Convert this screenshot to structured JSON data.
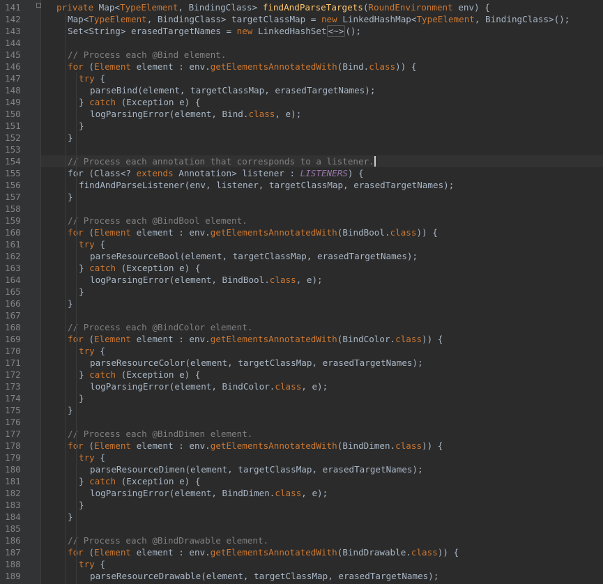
{
  "editor": {
    "first_line": 141,
    "current_line": 154,
    "lines": [
      {
        "n": "141",
        "i": 0,
        "t": [
          [
            "kw",
            "private "
          ],
          [
            "p",
            "Map<"
          ],
          [
            "type",
            "TypeElement"
          ],
          [
            "p",
            ", BindingClass> "
          ],
          [
            "fn",
            "findAndParseTargets"
          ],
          [
            "p",
            "("
          ],
          [
            "type",
            "RoundEnvironment"
          ],
          [
            "p",
            " env) {"
          ]
        ]
      },
      {
        "n": "142",
        "i": 1,
        "t": [
          [
            "p",
            "Map<"
          ],
          [
            "type",
            "TypeElement"
          ],
          [
            "p",
            ", BindingClass> targetClassMap = "
          ],
          [
            "kw",
            "new "
          ],
          [
            "p",
            "LinkedHashMap<"
          ],
          [
            "type",
            "TypeElement"
          ],
          [
            "p",
            ", BindingClass>();"
          ]
        ]
      },
      {
        "n": "143",
        "i": 1,
        "t": [
          [
            "p",
            "Set<String> erasedTargetNames = "
          ],
          [
            "kw",
            "new "
          ],
          [
            "p",
            "LinkedHashSet"
          ],
          [
            "hint",
            "<~>"
          ],
          [
            "p",
            "();"
          ]
        ]
      },
      {
        "n": "144",
        "i": 1,
        "t": []
      },
      {
        "n": "145",
        "i": 1,
        "t": [
          [
            "cm",
            "// Process each @Bind element."
          ]
        ]
      },
      {
        "n": "146",
        "i": 1,
        "t": [
          [
            "kw",
            "for "
          ],
          [
            "p",
            "("
          ],
          [
            "type",
            "Element"
          ],
          [
            "p",
            " element : env."
          ],
          [
            "type",
            "getElementsAnnotatedWith"
          ],
          [
            "p",
            "(Bind."
          ],
          [
            "kw",
            "class"
          ],
          [
            "p",
            ")) {"
          ]
        ]
      },
      {
        "n": "147",
        "i": 2,
        "t": [
          [
            "kw",
            "try "
          ],
          [
            "p",
            "{"
          ]
        ]
      },
      {
        "n": "148",
        "i": 3,
        "t": [
          [
            "p",
            "parseBind(element, targetClassMap, erasedTargetNames);"
          ]
        ]
      },
      {
        "n": "149",
        "i": 2,
        "t": [
          [
            "p",
            "} "
          ],
          [
            "kw",
            "catch "
          ],
          [
            "p",
            "(Exception e) {"
          ]
        ]
      },
      {
        "n": "150",
        "i": 3,
        "t": [
          [
            "p",
            "logParsingError(element, Bind."
          ],
          [
            "kw",
            "class"
          ],
          [
            "p",
            ", e);"
          ]
        ]
      },
      {
        "n": "151",
        "i": 2,
        "t": [
          [
            "p",
            "}"
          ]
        ]
      },
      {
        "n": "152",
        "i": 1,
        "t": [
          [
            "p",
            "}"
          ]
        ]
      },
      {
        "n": "153",
        "i": 1,
        "t": []
      },
      {
        "n": "154",
        "i": 1,
        "t": [
          [
            "cm",
            "// Process each annotation that corresponds to a listener."
          ]
        ]
      },
      {
        "n": "155",
        "i": 1,
        "t": [
          [
            "p",
            "for (Class<? "
          ],
          [
            "kw",
            "extends "
          ],
          [
            "p",
            "Annotation> listener : "
          ],
          [
            "const",
            "LISTENERS"
          ],
          [
            "p",
            ") {"
          ]
        ]
      },
      {
        "n": "156",
        "i": 2,
        "t": [
          [
            "p",
            "findAndParseListener(env, listener, targetClassMap, erasedTargetNames);"
          ]
        ]
      },
      {
        "n": "157",
        "i": 1,
        "t": [
          [
            "p",
            "}"
          ]
        ]
      },
      {
        "n": "158",
        "i": 1,
        "t": []
      },
      {
        "n": "159",
        "i": 1,
        "t": [
          [
            "cm",
            "// Process each @BindBool element."
          ]
        ]
      },
      {
        "n": "160",
        "i": 1,
        "t": [
          [
            "kw",
            "for "
          ],
          [
            "p",
            "("
          ],
          [
            "type",
            "Element"
          ],
          [
            "p",
            " element : env."
          ],
          [
            "type",
            "getElementsAnnotatedWith"
          ],
          [
            "p",
            "(BindBool."
          ],
          [
            "kw",
            "class"
          ],
          [
            "p",
            ")) {"
          ]
        ]
      },
      {
        "n": "161",
        "i": 2,
        "t": [
          [
            "kw",
            "try "
          ],
          [
            "p",
            "{"
          ]
        ]
      },
      {
        "n": "162",
        "i": 3,
        "t": [
          [
            "p",
            "parseResourceBool(element, targetClassMap, erasedTargetNames);"
          ]
        ]
      },
      {
        "n": "163",
        "i": 2,
        "t": [
          [
            "p",
            "} "
          ],
          [
            "kw",
            "catch "
          ],
          [
            "p",
            "(Exception e) {"
          ]
        ]
      },
      {
        "n": "164",
        "i": 3,
        "t": [
          [
            "p",
            "logParsingError(element, BindBool."
          ],
          [
            "kw",
            "class"
          ],
          [
            "p",
            ", e);"
          ]
        ]
      },
      {
        "n": "165",
        "i": 2,
        "t": [
          [
            "p",
            "}"
          ]
        ]
      },
      {
        "n": "166",
        "i": 1,
        "t": [
          [
            "p",
            "}"
          ]
        ]
      },
      {
        "n": "167",
        "i": 1,
        "t": []
      },
      {
        "n": "168",
        "i": 1,
        "t": [
          [
            "cm",
            "// Process each @BindColor element."
          ]
        ]
      },
      {
        "n": "169",
        "i": 1,
        "t": [
          [
            "kw",
            "for "
          ],
          [
            "p",
            "("
          ],
          [
            "type",
            "Element"
          ],
          [
            "p",
            " element : env."
          ],
          [
            "type",
            "getElementsAnnotatedWith"
          ],
          [
            "p",
            "(BindColor."
          ],
          [
            "kw",
            "class"
          ],
          [
            "p",
            ")) {"
          ]
        ]
      },
      {
        "n": "170",
        "i": 2,
        "t": [
          [
            "kw",
            "try "
          ],
          [
            "p",
            "{"
          ]
        ]
      },
      {
        "n": "171",
        "i": 3,
        "t": [
          [
            "p",
            "parseResourceColor(element, targetClassMap, erasedTargetNames);"
          ]
        ]
      },
      {
        "n": "172",
        "i": 2,
        "t": [
          [
            "p",
            "} "
          ],
          [
            "kw",
            "catch "
          ],
          [
            "p",
            "(Exception e) {"
          ]
        ]
      },
      {
        "n": "173",
        "i": 3,
        "t": [
          [
            "p",
            "logParsingError(element, BindColor."
          ],
          [
            "kw",
            "class"
          ],
          [
            "p",
            ", e);"
          ]
        ]
      },
      {
        "n": "174",
        "i": 2,
        "t": [
          [
            "p",
            "}"
          ]
        ]
      },
      {
        "n": "175",
        "i": 1,
        "t": [
          [
            "p",
            "}"
          ]
        ]
      },
      {
        "n": "176",
        "i": 1,
        "t": []
      },
      {
        "n": "177",
        "i": 1,
        "t": [
          [
            "cm",
            "// Process each @BindDimen element."
          ]
        ]
      },
      {
        "n": "178",
        "i": 1,
        "t": [
          [
            "kw",
            "for "
          ],
          [
            "p",
            "("
          ],
          [
            "type",
            "Element"
          ],
          [
            "p",
            " element : env."
          ],
          [
            "type",
            "getElementsAnnotatedWith"
          ],
          [
            "p",
            "(BindDimen."
          ],
          [
            "kw",
            "class"
          ],
          [
            "p",
            ")) {"
          ]
        ]
      },
      {
        "n": "179",
        "i": 2,
        "t": [
          [
            "kw",
            "try "
          ],
          [
            "p",
            "{"
          ]
        ]
      },
      {
        "n": "180",
        "i": 3,
        "t": [
          [
            "p",
            "parseResourceDimen(element, targetClassMap, erasedTargetNames);"
          ]
        ]
      },
      {
        "n": "181",
        "i": 2,
        "t": [
          [
            "p",
            "} "
          ],
          [
            "kw",
            "catch "
          ],
          [
            "p",
            "(Exception e) {"
          ]
        ]
      },
      {
        "n": "182",
        "i": 3,
        "t": [
          [
            "p",
            "logParsingError(element, BindDimen."
          ],
          [
            "kw",
            "class"
          ],
          [
            "p",
            ", e);"
          ]
        ]
      },
      {
        "n": "183",
        "i": 2,
        "t": [
          [
            "p",
            "}"
          ]
        ]
      },
      {
        "n": "184",
        "i": 1,
        "t": [
          [
            "p",
            "}"
          ]
        ]
      },
      {
        "n": "185",
        "i": 1,
        "t": []
      },
      {
        "n": "186",
        "i": 1,
        "t": [
          [
            "cm",
            "// Process each @BindDrawable element."
          ]
        ]
      },
      {
        "n": "187",
        "i": 1,
        "t": [
          [
            "kw",
            "for "
          ],
          [
            "p",
            "("
          ],
          [
            "type",
            "Element"
          ],
          [
            "p",
            " element : env."
          ],
          [
            "type",
            "getElementsAnnotatedWith"
          ],
          [
            "p",
            "(BindDrawable."
          ],
          [
            "kw",
            "class"
          ],
          [
            "p",
            ")) {"
          ]
        ]
      },
      {
        "n": "188",
        "i": 2,
        "t": [
          [
            "kw",
            "try "
          ],
          [
            "p",
            "{"
          ]
        ]
      },
      {
        "n": "189",
        "i": 3,
        "t": [
          [
            "p",
            "parseResourceDrawable(element, targetClassMap, erasedTargetNames);"
          ]
        ]
      }
    ]
  },
  "colors": {
    "background": "#2b2b2b",
    "gutter": "#313335",
    "keyword": "#cc7832",
    "method": "#ffc66d",
    "comment": "#808080",
    "constant": "#9876aa",
    "text": "#a9b7c6",
    "line_number": "#858585"
  }
}
